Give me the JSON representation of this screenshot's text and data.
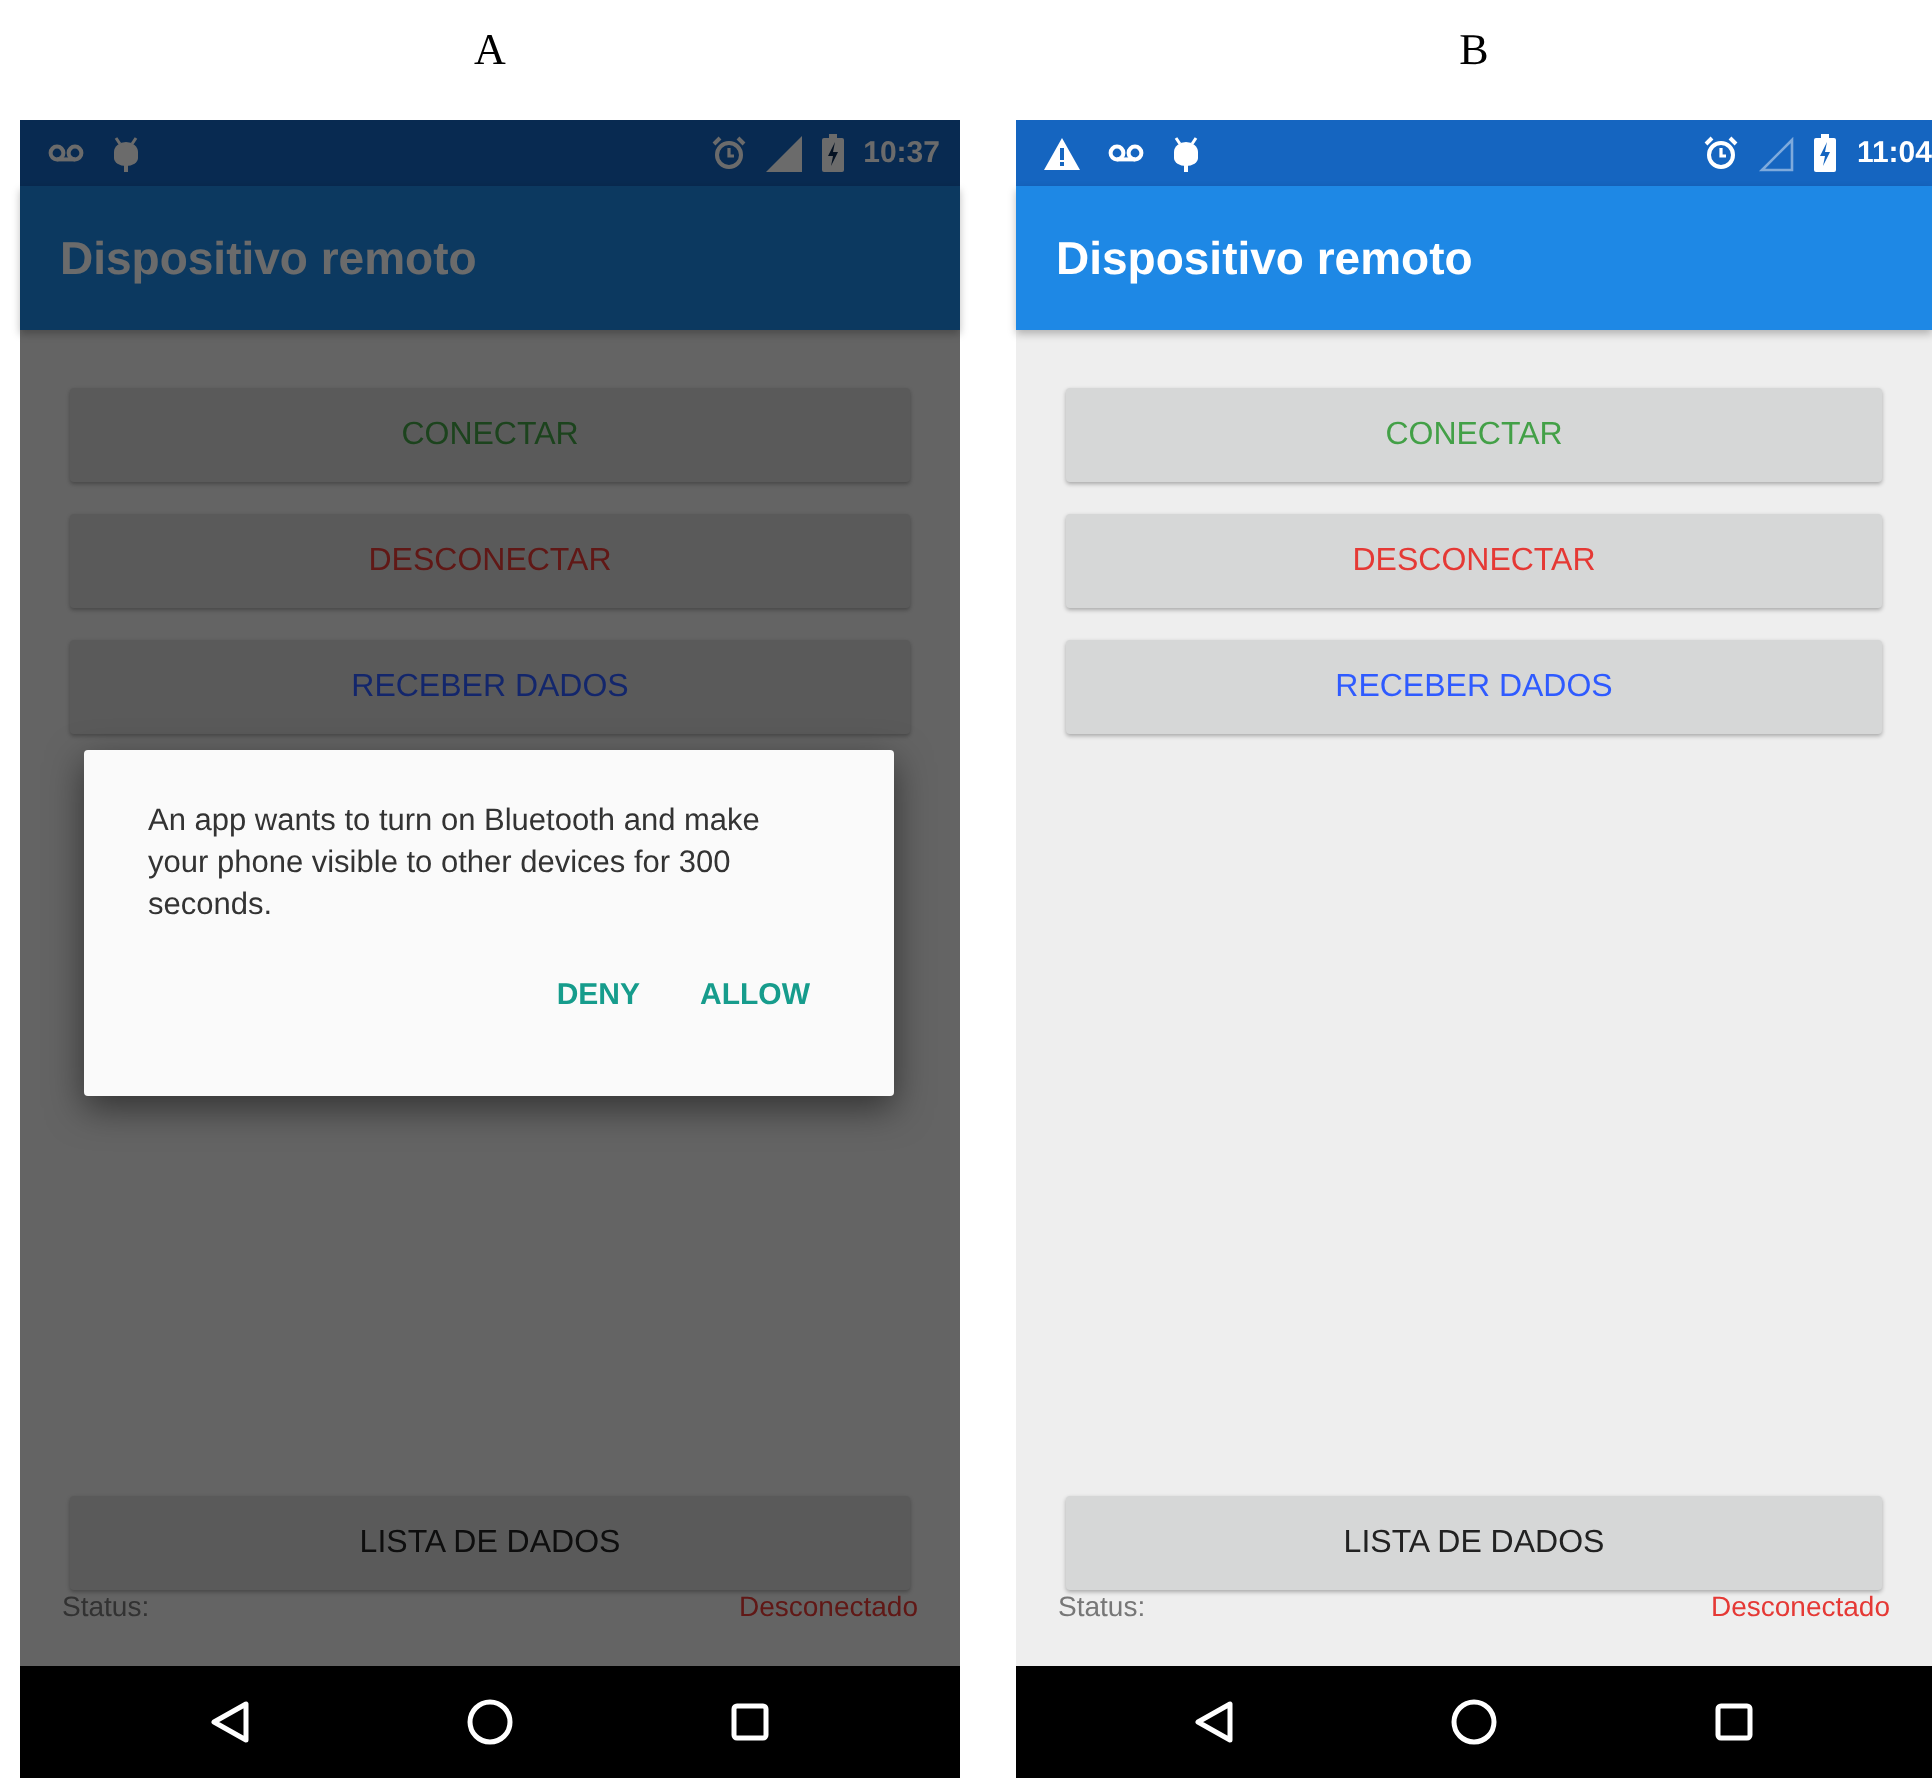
{
  "panels": [
    {
      "label": "A",
      "status_bar": {
        "notification_icons": [
          {
            "kind": "voicemail"
          },
          {
            "kind": "android"
          }
        ],
        "signal": {
          "kind": "full"
        },
        "time": "10:37"
      },
      "app_bar": {
        "title": "Dispositivo remoto"
      },
      "buttons": [
        {
          "label": "CONECTAR",
          "kind": "connect"
        },
        {
          "label": "DESCONECTAR",
          "kind": "disconnect"
        },
        {
          "label": "RECEBER DADOS",
          "kind": "receive"
        }
      ],
      "list_button": "LISTA DE DADOS",
      "status_label": "Status:",
      "status_value": "Desconectado",
      "dialog": {
        "message": "An app wants to turn on Bluetooth and make your phone visible to other devices for 300 seconds.",
        "actions": [
          "DENY",
          "ALLOW"
        ]
      }
    },
    {
      "label": "B",
      "status_bar": {
        "notification_icons": [
          {
            "kind": "warning"
          },
          {
            "kind": "voicemail"
          },
          {
            "kind": "android"
          }
        ],
        "signal": {
          "kind": "empty"
        },
        "time": "11:04"
      },
      "app_bar": {
        "title": "Dispositivo remoto"
      },
      "buttons": [
        {
          "label": "CONECTAR",
          "kind": "connect"
        },
        {
          "label": "DESCONECTAR",
          "kind": "disconnect"
        },
        {
          "label": "RECEBER DADOS",
          "kind": "receive"
        }
      ],
      "list_button": "LISTA DE DADOS",
      "status_label": "Status:",
      "status_value": "Desconectado"
    }
  ]
}
